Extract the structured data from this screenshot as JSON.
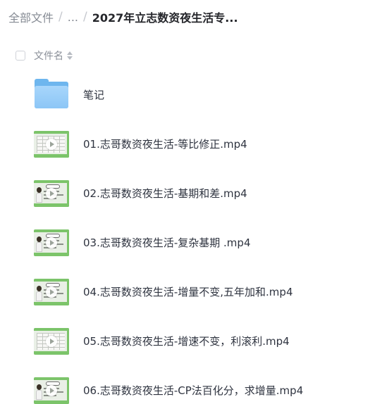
{
  "breadcrumb": {
    "root": "全部文件",
    "separator": "/",
    "ellipsis": "...",
    "current": "2027年立志数资夜生活专..."
  },
  "list_header": {
    "column_name": "文件名"
  },
  "files": [
    {
      "type": "folder",
      "icon": "folder-icon",
      "name": "笔记"
    },
    {
      "type": "video",
      "icon": "video-thumbnail",
      "thumb_style": "table",
      "name": "01.志哥数资夜生活-等比修正.mp4"
    },
    {
      "type": "video",
      "icon": "video-thumbnail",
      "thumb_style": "presenter",
      "name": "02.志哥数资夜生活-基期和差.mp4"
    },
    {
      "type": "video",
      "icon": "video-thumbnail",
      "thumb_style": "presenter",
      "name": "03.志哥数资夜生活-复杂基期 .mp4"
    },
    {
      "type": "video",
      "icon": "video-thumbnail",
      "thumb_style": "presenter",
      "name": "04.志哥数资夜生活-增量不变,五年加和.mp4"
    },
    {
      "type": "video",
      "icon": "video-thumbnail",
      "thumb_style": "table",
      "name": "05.志哥数资夜生活-增速不变，利滚利.mp4"
    },
    {
      "type": "video",
      "icon": "video-thumbnail",
      "thumb_style": "presenter",
      "name": "06.志哥数资夜生活-CP法百化分，求增量.mp4"
    }
  ],
  "colors": {
    "folder": "#8cc6f6",
    "thumb_accent": "#7cc46a",
    "text": "#2f3440",
    "muted": "#868b94"
  }
}
